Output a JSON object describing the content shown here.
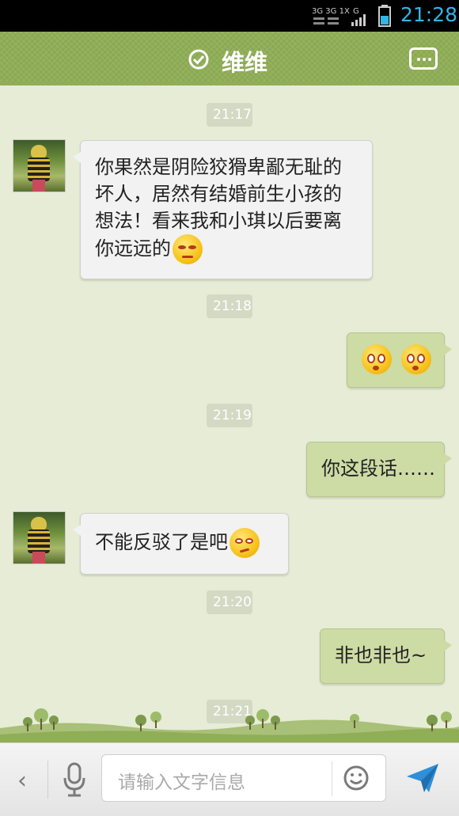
{
  "status_bar": {
    "network_label": "3G 3G 1X G",
    "time": "21:28",
    "time_color": "#33b5e5"
  },
  "header": {
    "title": "维维",
    "accent_color": "#8fae56",
    "menu_icon": "more-dots-icon",
    "verified_icon": "check-circle-icon"
  },
  "messages": [
    {
      "type": "timestamp",
      "text": "21:17"
    },
    {
      "type": "incoming",
      "text": "你果然是阴险狡猾卑鄙无耻的坏人，居然有结婚前生小孩的想法！看来我和小琪以后要离你远远的",
      "emoji": "grumpy-face-emoji"
    },
    {
      "type": "timestamp",
      "text": "21:18"
    },
    {
      "type": "outgoing",
      "text": "",
      "emoji": "surprised-face-emoji x2"
    },
    {
      "type": "timestamp",
      "text": "21:19"
    },
    {
      "type": "outgoing",
      "text": "你这段话……"
    },
    {
      "type": "incoming",
      "text": "不能反驳了是吧",
      "emoji": "smirk-face-emoji"
    },
    {
      "type": "timestamp",
      "text": "21:20"
    },
    {
      "type": "outgoing",
      "text": "非也非也~"
    },
    {
      "type": "timestamp",
      "text": "21:21"
    }
  ],
  "input_bar": {
    "placeholder": "请输入文字信息",
    "back_icon": "chevron-left-icon",
    "voice_icon": "microphone-icon",
    "emoji_icon": "smiley-icon",
    "send_icon": "paper-plane-send-icon"
  }
}
